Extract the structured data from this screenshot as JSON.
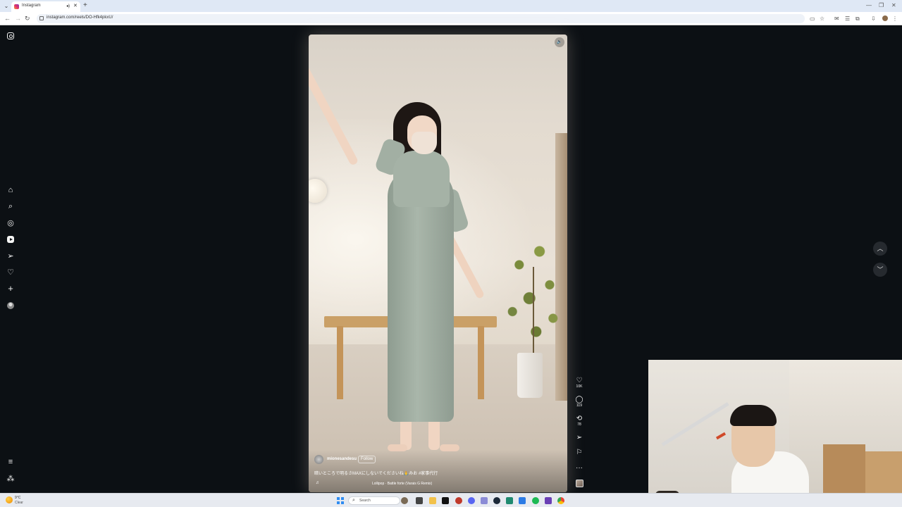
{
  "browser": {
    "tab_title": "Instagram",
    "url": "instagram.com/reels/DO-Hfk4pkxU/",
    "tab_list_icon": "chevron-down-icon",
    "new_tab_symbol": "+"
  },
  "sidebar": {
    "items": [
      {
        "name": "home",
        "icon": "home-icon",
        "glyph": "⌂"
      },
      {
        "name": "search",
        "icon": "search-icon",
        "glyph": "⌕"
      },
      {
        "name": "explore",
        "icon": "compass-icon",
        "glyph": "◎"
      },
      {
        "name": "reels",
        "icon": "reels-icon",
        "glyph": ""
      },
      {
        "name": "messages",
        "icon": "send-icon",
        "glyph": "➢"
      },
      {
        "name": "notifications",
        "icon": "heart-icon",
        "glyph": "♡"
      },
      {
        "name": "create",
        "icon": "plus-icon",
        "glyph": "+"
      },
      {
        "name": "profile",
        "icon": "avatar",
        "glyph": ""
      }
    ],
    "more_glyph": "≡",
    "threads_glyph": "⁂"
  },
  "reel": {
    "author": "mionesandesu",
    "follow_label": "Follow",
    "caption": "暗いところで明るさMAXにしないでくださいね🙏みお #家事代行",
    "audio": "Lollipop · Battle forte (Varais G Remix)",
    "music_glyph": "♬",
    "mute_glyph": "🔈"
  },
  "actions": [
    {
      "name": "like",
      "icon": "heart-icon",
      "glyph": "♡",
      "count": "10K"
    },
    {
      "name": "comment",
      "icon": "comment-icon",
      "glyph": "◯",
      "count": "119"
    },
    {
      "name": "repost",
      "icon": "repost-icon",
      "glyph": "⟲",
      "count": "78"
    },
    {
      "name": "share",
      "icon": "send-icon",
      "glyph": "➢",
      "count": ""
    },
    {
      "name": "save",
      "icon": "bookmark-icon",
      "glyph": "⚐",
      "count": ""
    },
    {
      "name": "more",
      "icon": "more-icon",
      "glyph": "···",
      "count": ""
    }
  ],
  "nav": {
    "up_glyph": "︿",
    "down_glyph": "﹀"
  },
  "taskbar": {
    "weather_temp": "9°C",
    "weather_desc": "Clear",
    "search_label": "Search",
    "search_glyph": "⌕"
  },
  "colors": {
    "page_bg": "#0c1014",
    "sidebar_icon": "#f5f5f5",
    "nav_arrow_bg": "#262a2f"
  }
}
